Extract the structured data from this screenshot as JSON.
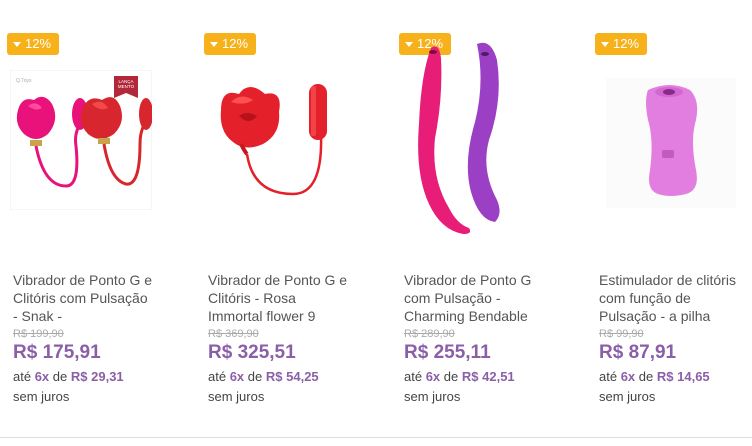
{
  "products": [
    {
      "discount": "12%",
      "title": "Vibrador de Ponto G e Clitóris com Pulsação - Snak -",
      "old_price": "R$ 199,90",
      "price": "R$ 175,91",
      "inst_prefix": "até",
      "inst_count": "6x",
      "inst_de": "de",
      "inst_value": "R$ 29,31",
      "inst_suffix": "sem juros",
      "image_label": "LANÇA MENTO"
    },
    {
      "discount": "12%",
      "title": "Vibrador de Ponto G e Clitóris - Rosa Immortal flower 9",
      "old_price": "R$ 369,90",
      "price": "R$ 325,51",
      "inst_prefix": "até",
      "inst_count": "6x",
      "inst_de": "de",
      "inst_value": "R$ 54,25",
      "inst_suffix": "sem juros"
    },
    {
      "discount": "12%",
      "title": "Vibrador de Ponto G com Pulsação - Charming Bendable",
      "old_price": "R$ 289,90",
      "price": "R$ 255,11",
      "inst_prefix": "até",
      "inst_count": "6x",
      "inst_de": "de",
      "inst_value": "R$ 42,51",
      "inst_suffix": "sem juros"
    },
    {
      "discount": "12%",
      "title": "Estimulador de clitóris com função de Pulsação - a pilha",
      "old_price": "R$ 99,90",
      "price": "R$ 87,91",
      "inst_prefix": "até",
      "inst_count": "6x",
      "inst_de": "de",
      "inst_value": "R$ 14,65",
      "inst_suffix": "sem juros"
    }
  ],
  "colors": {
    "badge": "#f7b21b",
    "price": "#8a5fa8",
    "old_price": "#aaaaaa",
    "title": "#555555"
  }
}
